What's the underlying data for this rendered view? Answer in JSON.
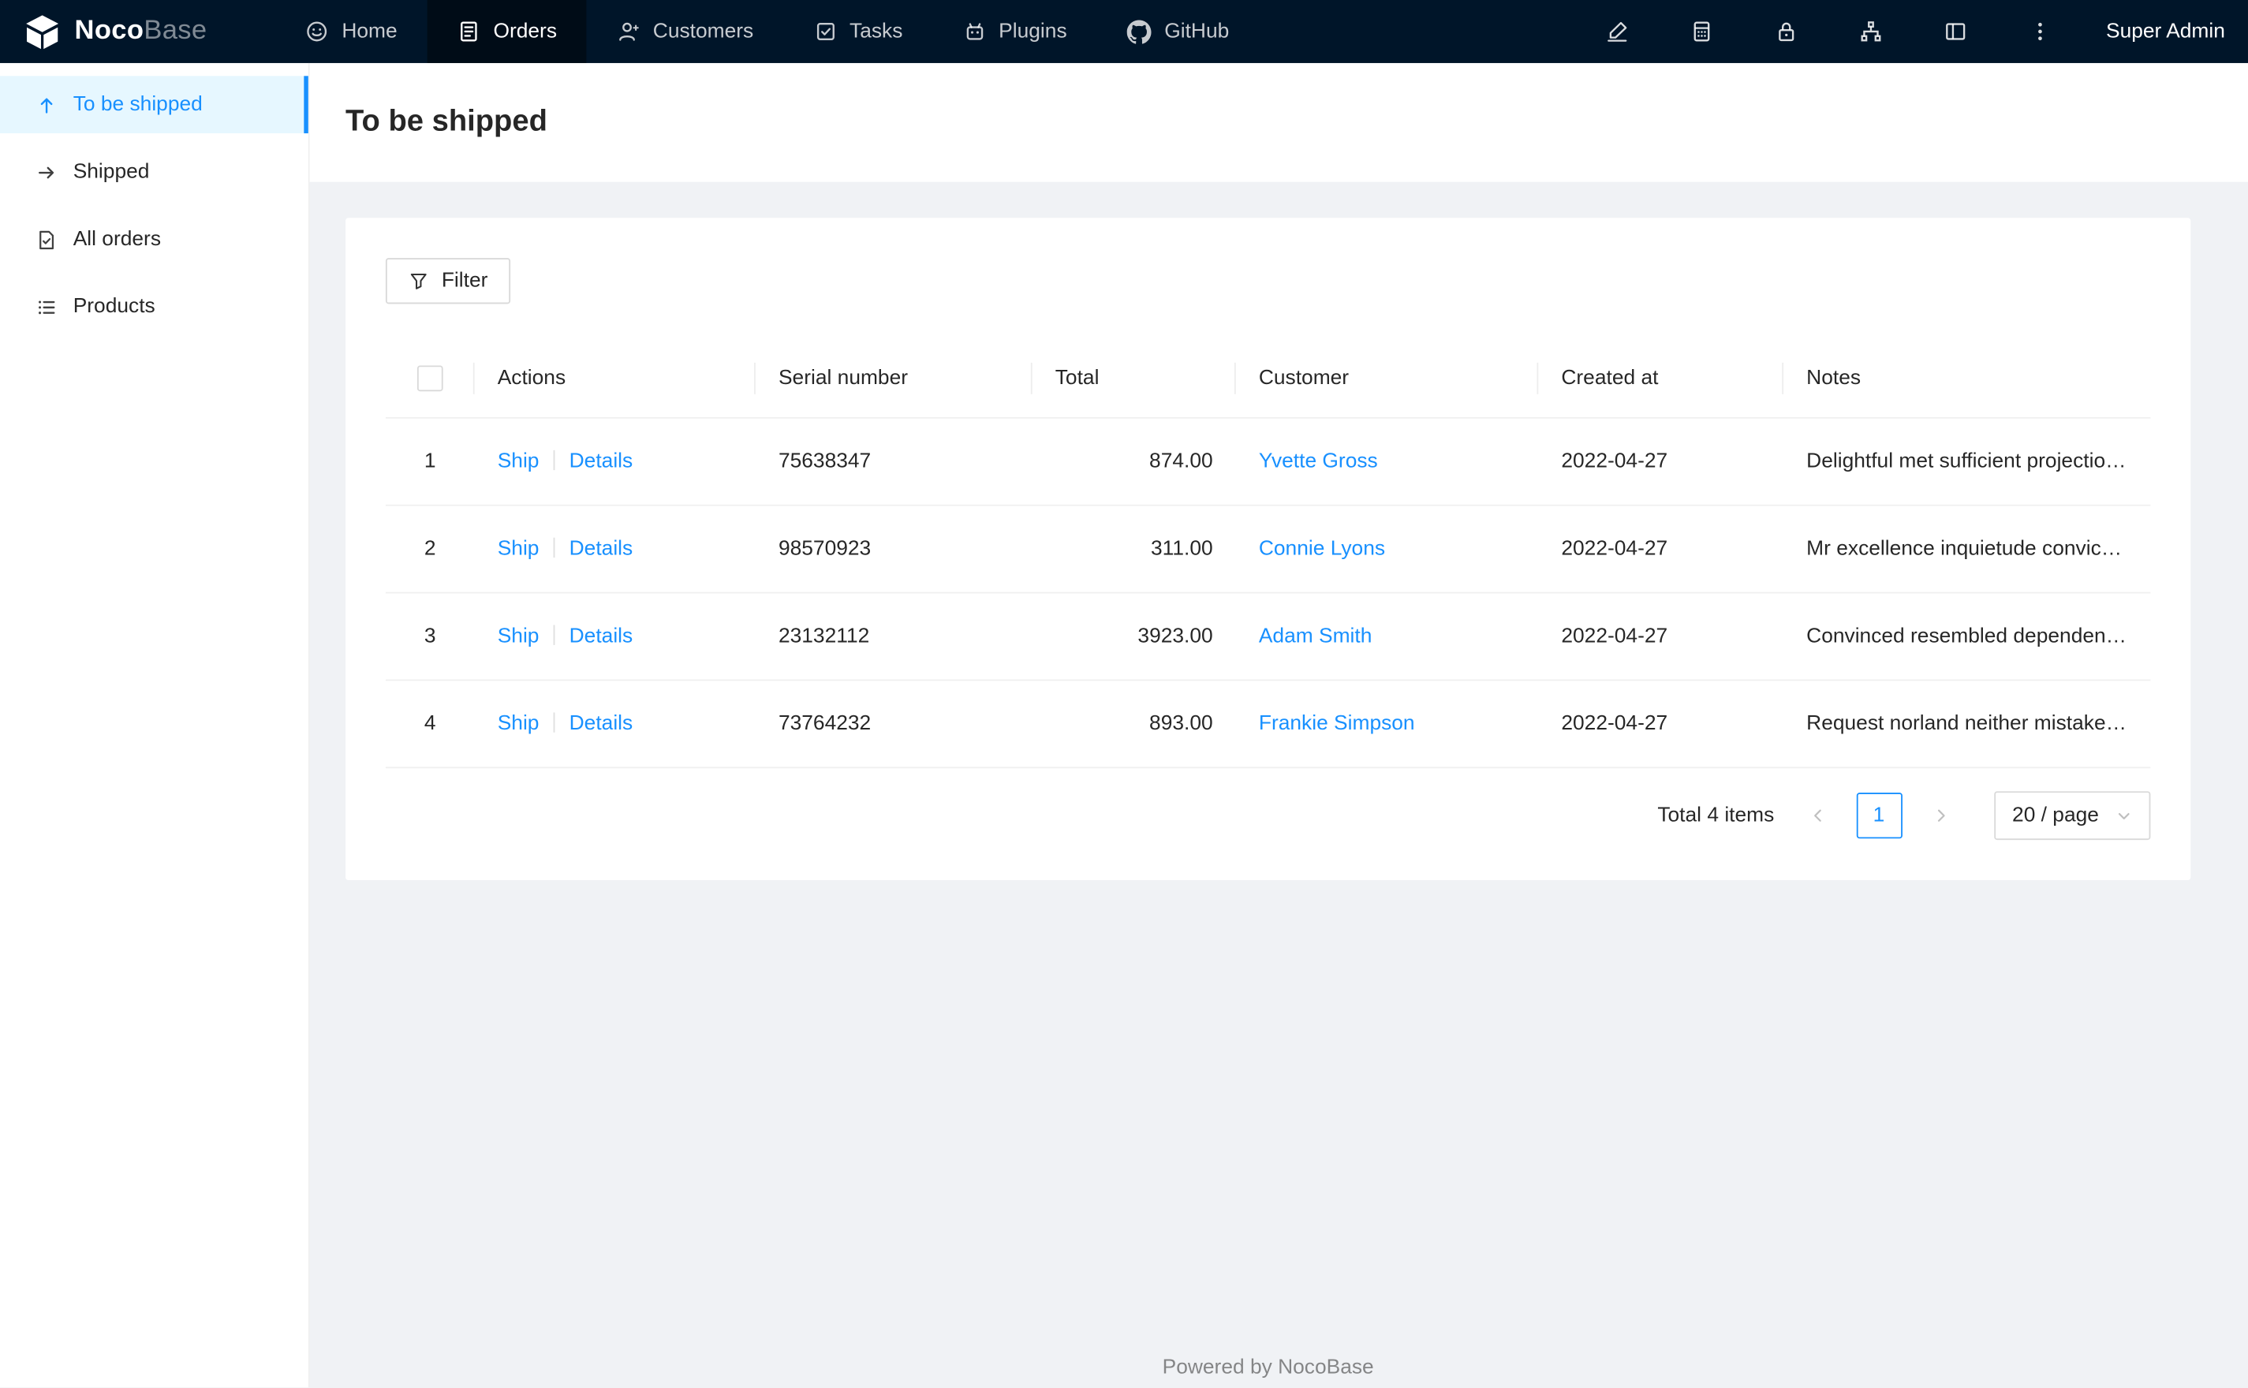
{
  "navbar": {
    "logo": {
      "text_bold": "Noco",
      "text_light": "Base"
    },
    "items": [
      {
        "label": "Home",
        "icon": "home-icon"
      },
      {
        "label": "Orders",
        "icon": "orders-icon",
        "active": true
      },
      {
        "label": "Customers",
        "icon": "customers-icon"
      },
      {
        "label": "Tasks",
        "icon": "tasks-icon"
      },
      {
        "label": "Plugins",
        "icon": "plugins-icon"
      },
      {
        "label": "GitHub",
        "icon": "github-icon"
      }
    ],
    "right_icons": [
      "highlight-icon",
      "calculator-icon",
      "lock-icon",
      "apartment-icon",
      "layout-icon",
      "more-icon"
    ],
    "user": "Super Admin"
  },
  "sidebar": {
    "items": [
      {
        "label": "To be shipped",
        "icon": "arrow-up-icon",
        "active": true
      },
      {
        "label": "Shipped",
        "icon": "arrow-right-icon"
      },
      {
        "label": "All orders",
        "icon": "file-done-icon"
      },
      {
        "label": "Products",
        "icon": "list-icon"
      }
    ]
  },
  "page": {
    "title": "To be shipped"
  },
  "toolbar": {
    "filter_label": "Filter",
    "filter_icon": "filter-icon"
  },
  "table": {
    "columns": {
      "actions": "Actions",
      "serial": "Serial number",
      "total": "Total",
      "customer": "Customer",
      "created": "Created at",
      "notes": "Notes"
    },
    "rows": [
      {
        "index": "1",
        "ship": "Ship",
        "details": "Details",
        "serial": "75638347",
        "total": "874.00",
        "customer": "Yvette Gross",
        "created": "2022-04-27",
        "notes": "Delightful met sufficient projection ask. Decisively ev..."
      },
      {
        "index": "2",
        "ship": "Ship",
        "details": "Details",
        "serial": "98570923",
        "total": "311.00",
        "customer": "Connie Lyons",
        "created": "2022-04-27",
        "notes": "Mr excellence inquietude conviction is in unreserved..."
      },
      {
        "index": "3",
        "ship": "Ship",
        "details": "Details",
        "serial": "23132112",
        "total": "3923.00",
        "customer": "Adam Smith",
        "created": "2022-04-27",
        "notes": "Convinced resembled dependent remainder led zeal..."
      },
      {
        "index": "4",
        "ship": "Ship",
        "details": "Details",
        "serial": "73764232",
        "total": "893.00",
        "customer": "Frankie Simpson",
        "created": "2022-04-27",
        "notes": "Request norland neither mistake for yet. Between th..."
      }
    ]
  },
  "pagination": {
    "total_text": "Total 4 items",
    "current_page": "1",
    "page_size": "20 / page"
  },
  "footer": {
    "text": "Powered by NocoBase"
  },
  "colors": {
    "accent": "#1890ff",
    "navbar_bg": "#001529",
    "navbar_active_bg": "#000c17",
    "sidebar_active_bg": "#e6f7ff",
    "content_bg": "#f0f2f5"
  }
}
